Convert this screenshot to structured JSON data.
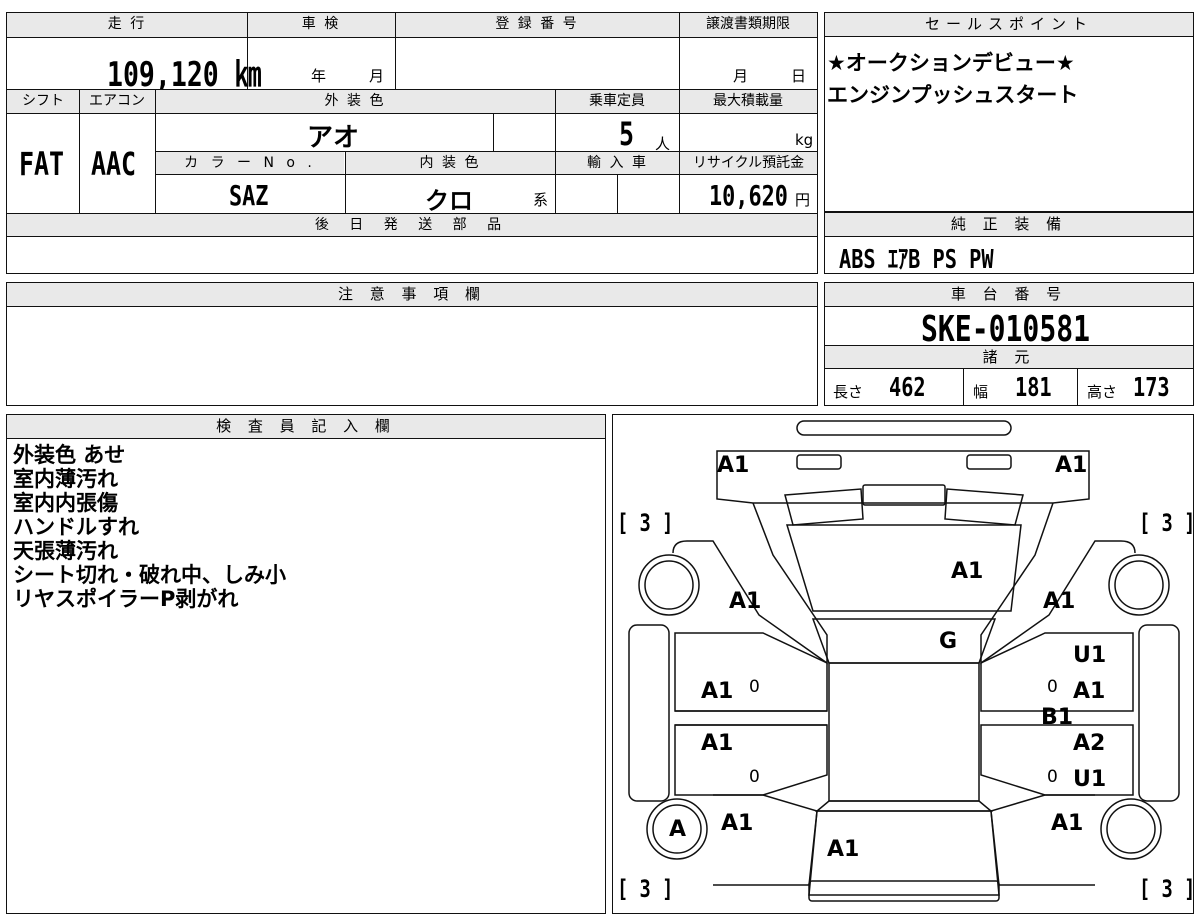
{
  "basic": {
    "mileage_label": "走 行",
    "mileage_value": "109,120 ㎞",
    "shaken_label": "車 検",
    "shaken_year": "年",
    "shaken_month": "月",
    "reg_label": "登 録 番 号",
    "deadline_label": "譲渡書類期限",
    "deadline_month": "月",
    "deadline_day": "日",
    "shift_label": "シフト",
    "shift_value": "FAT",
    "aircon_label": "エアコン",
    "aircon_value": "AAC",
    "ext_color_label": "外 装 色",
    "ext_color_value": "アオ",
    "capacity_label": "乗車定員",
    "capacity_value": "5",
    "capacity_unit": "人",
    "load_label": "最大積載量",
    "load_unit": "kg",
    "color_no_label": "カ ラ ー N o .",
    "color_no_value": "SAZ",
    "int_color_label": "内 装 色",
    "int_color_value": "クロ",
    "int_color_suffix": "系",
    "import_label": "輸 入 車",
    "recycle_label": "リサイクル預託金",
    "recycle_value": "10,620",
    "recycle_unit": "円",
    "later_parts_label": "後 日 発 送 部 品"
  },
  "sales": {
    "label": "セールスポイント",
    "lines": [
      "★オークションデビュー★",
      "エンジンプッシュスタート"
    ]
  },
  "equipment": {
    "label": "純 正 装 備",
    "value": "ABS ｴｱB PS PW"
  },
  "notes": {
    "label": "注 意 事 項 欄"
  },
  "chassis": {
    "label": "車 台 番 号",
    "value": "SKE-010581",
    "spec_label": "諸 元",
    "length_label": "長さ",
    "length_value": "462",
    "width_label": "幅",
    "width_value": "181",
    "height_label": "高さ",
    "height_value": "173"
  },
  "inspector": {
    "label": "検 査 員 記 入 欄",
    "remarks": [
      "外装色 あせ",
      "室内薄汚れ",
      "室内内張傷",
      "ハンドルすれ",
      "天張薄汚れ",
      "シート切れ・破れ中、しみ小",
      "リヤスポイラーP剥がれ"
    ]
  },
  "diagram": {
    "tire_fl": "[ 3 ]",
    "tire_fr": "[ 3 ]",
    "tire_rl": "[ 3 ]",
    "tire_rr": "[ 3 ]",
    "marks": {
      "front_left": "A1",
      "front_right": "A1",
      "hood": "A1",
      "fender_left": "A1",
      "fender_right": "A1",
      "windshield": "G",
      "right_front_door_top": "U1",
      "right_front_door": "A1",
      "right_pillar": "B1",
      "right_rear_door": "A2",
      "right_rear_door_bottom": "U1",
      "left_front_door": "A1",
      "left_rear_door": "A1",
      "left_rear_wheel": "A",
      "left_quarter": "A1",
      "right_quarter": "A1",
      "rear": "A1",
      "zero_1": "0",
      "zero_2": "0",
      "zero_3": "0",
      "zero_4": "0"
    }
  }
}
